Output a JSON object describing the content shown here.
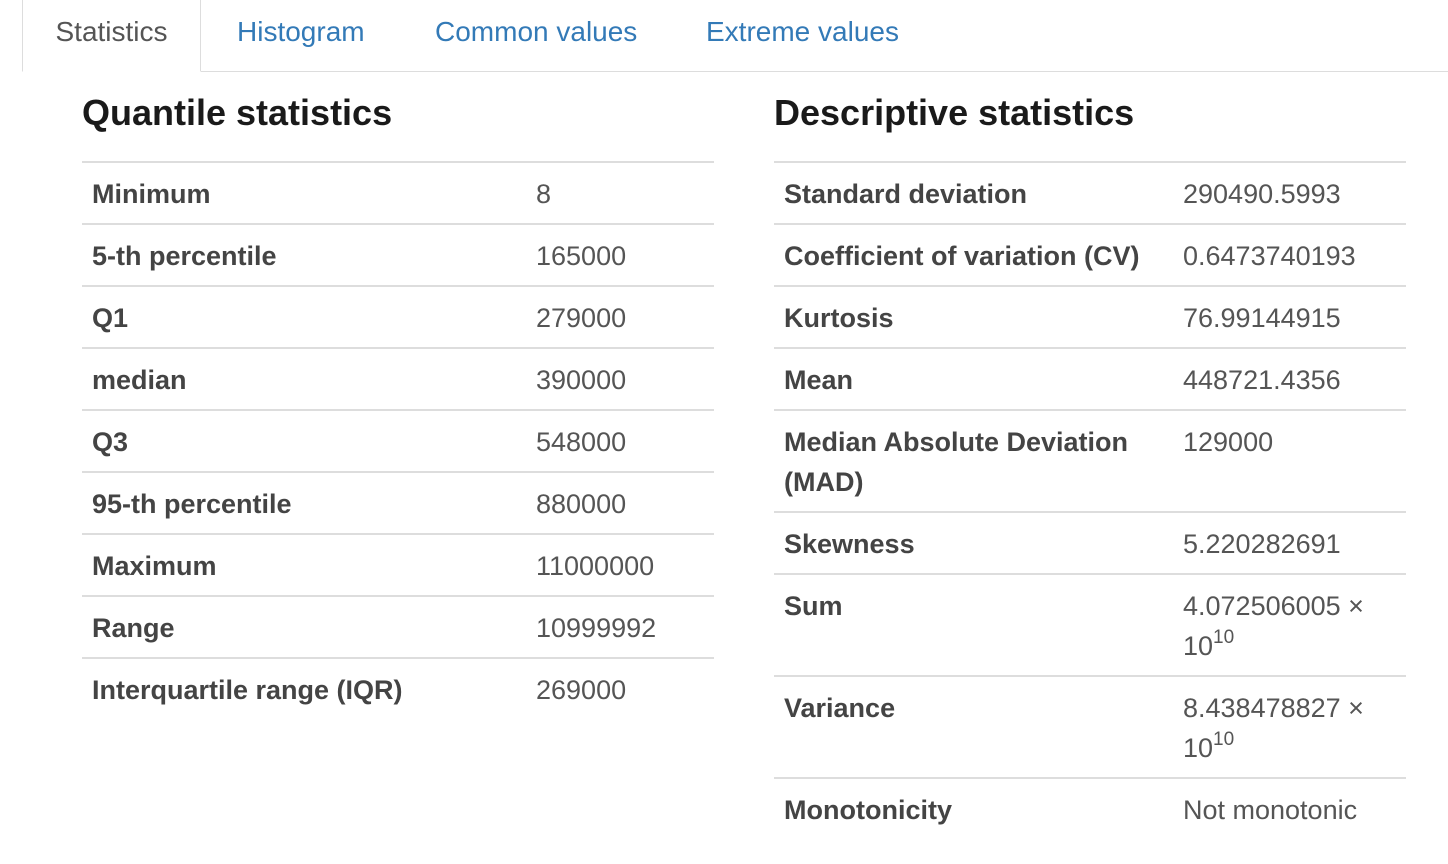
{
  "tabs": [
    {
      "label": "Statistics",
      "active": true
    },
    {
      "label": "Histogram",
      "active": false
    },
    {
      "label": "Common values",
      "active": false
    },
    {
      "label": "Extreme values",
      "active": false
    }
  ],
  "quantile": {
    "title": "Quantile statistics",
    "rows": [
      {
        "label": "Minimum",
        "value": "8"
      },
      {
        "label": "5-th percentile",
        "value": "165000"
      },
      {
        "label": "Q1",
        "value": "279000"
      },
      {
        "label": "median",
        "value": "390000"
      },
      {
        "label": "Q3",
        "value": "548000"
      },
      {
        "label": "95-th percentile",
        "value": "880000"
      },
      {
        "label": "Maximum",
        "value": "11000000"
      },
      {
        "label": "Range",
        "value": "10999992"
      },
      {
        "label": "Interquartile range (IQR)",
        "value": "269000"
      }
    ]
  },
  "descriptive": {
    "title": "Descriptive statistics",
    "rows": [
      {
        "label": "Standard deviation",
        "value": "290490.5993"
      },
      {
        "label": "Coefficient of variation (CV)",
        "value": "0.6473740193"
      },
      {
        "label": "Kurtosis",
        "value": "76.99144915"
      },
      {
        "label": "Mean",
        "value": "448721.4356"
      },
      {
        "label": "Median Absolute Deviation (MAD)",
        "value": "129000"
      },
      {
        "label": "Skewness",
        "value": "5.220282691"
      },
      {
        "label": "Sum",
        "value": "4.072506005 × 10",
        "exponent": "10"
      },
      {
        "label": "Variance",
        "value": "8.438478827 × 10",
        "exponent": "10"
      },
      {
        "label": "Monotonicity",
        "value": "Not monotonic"
      }
    ]
  },
  "colors": {
    "link": "#337ab7",
    "border": "#dddddd",
    "heading": "#1a1a1a"
  }
}
